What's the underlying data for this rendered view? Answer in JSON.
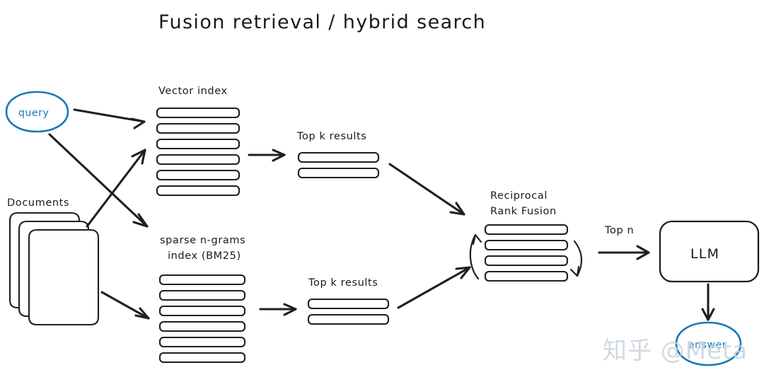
{
  "title": "Fusion retrieval / hybrid search",
  "nodes": {
    "query": {
      "label": "query",
      "color": "#1878b9"
    },
    "documents": {
      "label": "Documents"
    },
    "vector_index": {
      "label": "Vector index",
      "bars": 6
    },
    "sparse_index": {
      "label_line1": "sparse n-grams",
      "label_line2": "index (BM25)",
      "bars": 6
    },
    "topk_vector": {
      "label": "Top k results",
      "bars": 2
    },
    "topk_sparse": {
      "label": "Top k results",
      "bars": 2
    },
    "rrf": {
      "label_line1": "Reciprocal",
      "label_line2": "Rank Fusion",
      "bars": 4
    },
    "topn": {
      "label": "Top n"
    },
    "llm": {
      "label": "LLM"
    },
    "answer": {
      "label": "answer",
      "color": "#1878b9"
    }
  },
  "watermark": {
    "text": "知乎 @Meta",
    "color": "#c9d3dc"
  }
}
